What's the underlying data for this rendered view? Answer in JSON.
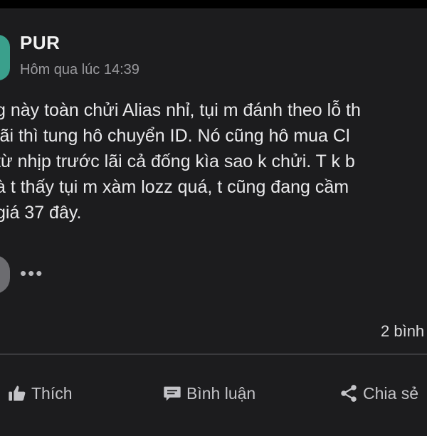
{
  "post": {
    "author": "PUR",
    "timestamp": "Hôm qua lúc 14:39",
    "lines": [
      "g này toàn chửi Alias nhỉ, tụi m đánh theo lỗ th",
      " lãi thì tung hô chuyển ID. Nó cũng hô mua Cl",
      " từ nhịp trước lãi cả đống kìa sao k chửi. T k b",
      "à t thấy tụi m xàm lozz quá, t cũng đang cầm",
      " giá 37 đây."
    ],
    "more": "•••",
    "comment_count": "2 bình"
  },
  "actions": {
    "like": "Thích",
    "comment": "Bình luận",
    "share": "Chia sẻ"
  }
}
